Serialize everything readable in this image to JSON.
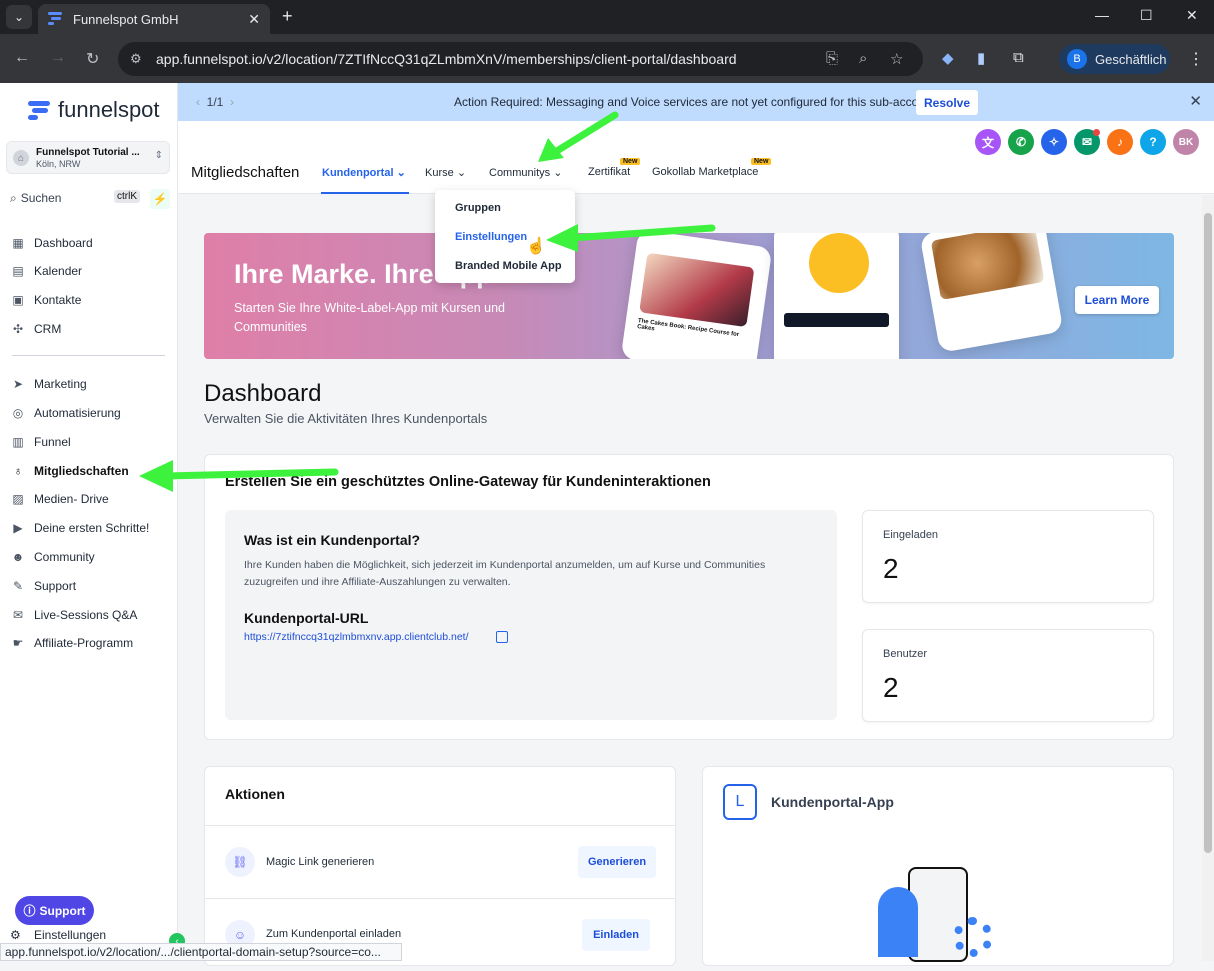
{
  "browser": {
    "tab_title": "Funnelspot GmbH",
    "url": "app.funnelspot.io/v2/location/7ZTIfNccQ31qZLmbmXnV/memberships/client-portal/dashboard",
    "profile_label": "Geschäftlich",
    "profile_initial": "B",
    "status_url": "app.funnelspot.io/v2/location/.../clientportal-domain-setup?source=co..."
  },
  "sidebar": {
    "brand": "funnelspot",
    "location_name": "Funnelspot Tutorial ...",
    "location_city": "Köln, NRW",
    "search_label": "Suchen",
    "search_shortcut": "ctrlK",
    "items": [
      {
        "label": "Dashboard",
        "icon": "grid-icon"
      },
      {
        "label": "Kalender",
        "icon": "calendar-icon"
      },
      {
        "label": "Kontakte",
        "icon": "contacts-icon"
      },
      {
        "label": "CRM",
        "icon": "crm-icon"
      },
      {
        "label": "Marketing",
        "icon": "send-icon"
      },
      {
        "label": "Automatisierung",
        "icon": "automation-icon"
      },
      {
        "label": "Funnel",
        "icon": "funnel-icon"
      },
      {
        "label": "Mitgliedschaften",
        "icon": "award-icon"
      },
      {
        "label": "Medien- Drive",
        "icon": "image-icon"
      },
      {
        "label": "Deine ersten Schritte!",
        "icon": "play-icon"
      },
      {
        "label": "Community",
        "icon": "users-icon"
      },
      {
        "label": "Support",
        "icon": "wrench-icon"
      },
      {
        "label": "Live-Sessions Q&A",
        "icon": "chat-icon"
      },
      {
        "label": "Affiliate-Programm",
        "icon": "hand-icon"
      }
    ],
    "support_button": "Support",
    "settings_label": "Einstellungen"
  },
  "alert": {
    "pagination": "1/1",
    "message": "Action Required: Messaging and Voice services are not yet configured for this sub-account!",
    "resolve": "Resolve"
  },
  "header": {
    "title": "Mitgliedschaften",
    "tabs": [
      "Kundenportal",
      "Kurse",
      "Communitys",
      "Zertifikat",
      "Gokollab Marketplace"
    ],
    "new_badge": "New",
    "avatar_initials": "BK"
  },
  "dropdown": {
    "items": [
      "Gruppen",
      "Einstellungen",
      "Branded Mobile App"
    ]
  },
  "hero": {
    "title": "Ihre Marke. Ihre App.",
    "subtitle": "Starten Sie Ihre White-Label-App mit Kursen und Communities",
    "learn_more": "Learn More",
    "phone_caption": "The Cakes Book: Recipe Course for Cakes"
  },
  "dashboard": {
    "title": "Dashboard",
    "subtitle": "Verwalten Sie die Aktivitäten Ihres Kundenportals",
    "gateway_heading": "Erstellen Sie ein geschütztes Online-Gateway für Kundeninteraktionen",
    "what_heading": "Was ist ein Kundenportal?",
    "what_text": "Ihre Kunden haben die Möglichkeit, sich jederzeit im Kundenportal anzumelden, um auf Kurse und Communities zuzugreifen und ihre Affiliate-Auszahlungen zu verwalten.",
    "url_heading": "Kundenportal-URL",
    "url": "https://7ztifnccq31qzlmbmxnv.app.clientclub.net/",
    "stats": [
      {
        "label": "Eingeladen",
        "value": "2"
      },
      {
        "label": "Benutzer",
        "value": "2"
      }
    ],
    "actions_heading": "Aktionen",
    "actions": [
      {
        "label": "Magic Link generieren",
        "button": "Generieren"
      },
      {
        "label": "Zum Kundenportal einladen",
        "button": "Einladen"
      }
    ],
    "app_heading": "Kundenportal-App"
  },
  "colors": {
    "accent": "#2563eb",
    "arrow": "#3df23d",
    "banner": "#bfdbfe"
  }
}
